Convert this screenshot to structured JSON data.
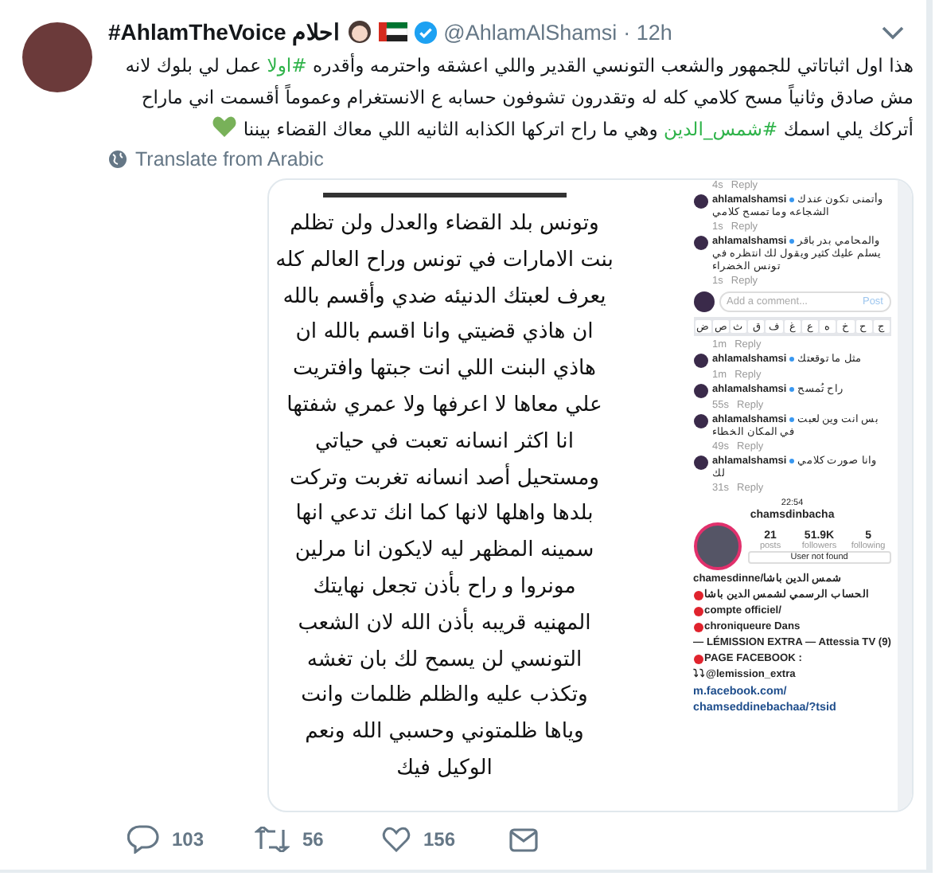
{
  "tweet": {
    "display_name": "#AhlamTheVoice احلام",
    "verified": true,
    "handle": "@AhlamAlShamsi",
    "time": "· 12h",
    "text": [
      "هذا اول اثباتاتي للجمهور والشعب التونسي القدير واللي اعشقه واحترمه وأقدره ",
      "#اولا",
      " عمل لي بلوك لانه مش صادق وثانياً مسح كلامي كله له وتقدرون تشوفون حسابه ع الانستغرام وعموماً أقسمت اني ماراح أتركك يلي اسمك ",
      "#شمس_الدين",
      "  وهي ما راح اتركها الكذابه الثانيه اللي معاك القضاء بيننا"
    ],
    "translate": "Translate from Arabic"
  },
  "statement_image": {
    "lines": [
      "وتونس بلد القضاء والعدل ولن تظلم",
      "بنت الامارات في تونس وراح العالم كله",
      "يعرف لعبتك الدنيئه ضدي وأقسم بالله",
      "ان هاذي قضيتي وانا اقسم بالله ان",
      "هاذي البنت اللي انت جبتها وافتريت",
      "علي معاها لا اعرفها ولا عمري شفتها",
      "انا اكثر انسانه تعبت في حياتي",
      "ومستحيل أصد انسانه تغربت وتركت",
      "بلدها واهلها لانها كما انك تدعي انها",
      "سمينه المظهر ليه لايكون انا مرلين",
      "مونروا و راح بأذن تجعل نهايتك",
      "المهنيه قريبه بأذن الله لان الشعب",
      "التونسي لن يسمح لك بان تغشه",
      "وتكذب عليه  والظلم ظلمات وانت",
      "وياها ظلمتوني وحسبي الله ونعم",
      "الوكيل فيك"
    ]
  },
  "comments_top": [
    {
      "kind": "meta",
      "time": "4s",
      "reply": "Reply"
    },
    {
      "kind": "comment",
      "user": "ahlamalshamsi",
      "text": "وأتمنى تكون عندك الشجاعه وما تمسح كلامي",
      "time": "1s",
      "reply": "Reply"
    },
    {
      "kind": "comment",
      "user": "ahlamalshamsi",
      "text": "والمحامي بدر باقر يسلم عليك كثير ويقول لك انتظره في تونس الخضراء",
      "time": "1s",
      "reply": "Reply"
    }
  ],
  "comment_box": {
    "placeholder": "Add a comment...",
    "post": "Post"
  },
  "keyboard": [
    "ج",
    "ح",
    "خ",
    "ه",
    "ع",
    "غ",
    "ف",
    "ق",
    "ث",
    "ص",
    "ض"
  ],
  "comments_bottom": [
    {
      "kind": "meta",
      "time": "1m",
      "reply": "Reply"
    },
    {
      "kind": "comment",
      "user": "ahlamalshamsi",
      "text": "مثل ما توقعتك",
      "time": "1m",
      "reply": "Reply"
    },
    {
      "kind": "comment",
      "user": "ahlamalshamsi",
      "text": "راح تُمسح",
      "time": "55s",
      "reply": "Reply"
    },
    {
      "kind": "comment",
      "user": "ahlamalshamsi",
      "text": "بس انت وين لعبت في المكان الخطاء",
      "time": "49s",
      "reply": "Reply"
    },
    {
      "kind": "comment",
      "user": "ahlamalshamsi",
      "text": "وانا صورت كلامي لك",
      "time": "31s",
      "reply": "Reply"
    }
  ],
  "profile": {
    "clock": "22:54",
    "username": "chamsdinbacha",
    "stats": [
      {
        "value": "5",
        "label": "following"
      },
      {
        "value": "51.9K",
        "label": "followers"
      },
      {
        "value": "21",
        "label": "posts"
      }
    ],
    "button": "User not found",
    "bio": [
      {
        "dot": false,
        "text": "chamesdinne/شمس الدين باشا"
      },
      {
        "dot": true,
        "text": "الحساب الرسمي لشمس الدين باشا"
      },
      {
        "dot": true,
        "text": "compte officiel/"
      },
      {
        "dot": true,
        "text": "chroniqueure Dans"
      },
      {
        "dot": false,
        "text": "— LÉMISSION EXTRA — Attessia TV (9)"
      },
      {
        "dot": true,
        "text": "PAGE FACEBOOK :"
      },
      {
        "dot": false,
        "text": "⤵⤵@lemission_extra"
      }
    ],
    "link": [
      "m.facebook.com/",
      "chamseddinebachaa/?tsid"
    ]
  },
  "actions": [
    {
      "kind": "mail"
    },
    {
      "kind": "like",
      "count": "156"
    },
    {
      "kind": "retweet",
      "count": "56"
    },
    {
      "kind": "reply",
      "count": "103"
    }
  ]
}
